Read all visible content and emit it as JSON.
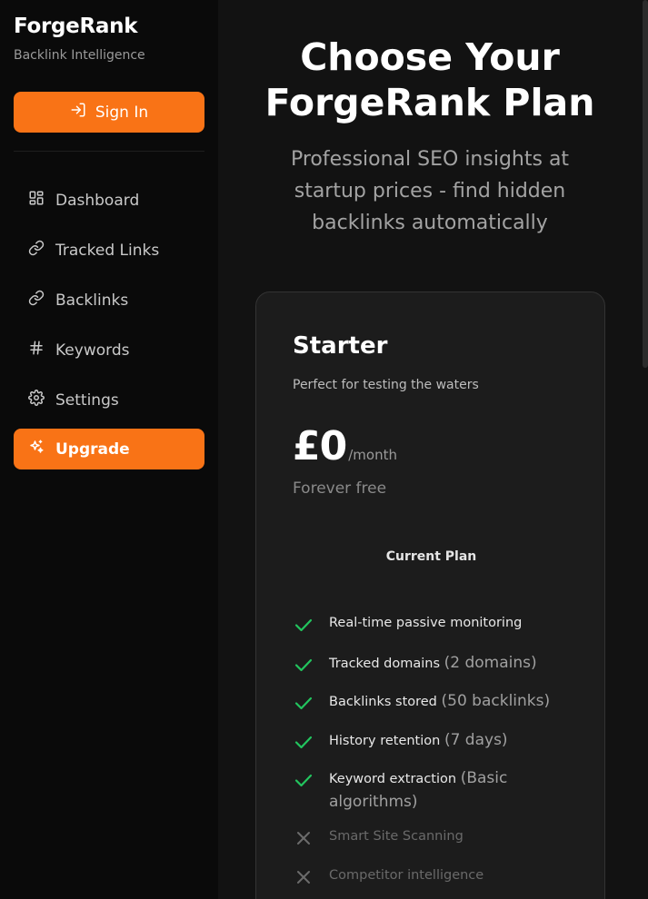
{
  "sidebar": {
    "brand": "ForgeRank",
    "tagline": "Backlink Intelligence",
    "sign_in_label": "Sign In",
    "nav": [
      {
        "label": "Dashboard",
        "icon": "dashboard-icon"
      },
      {
        "label": "Tracked Links",
        "icon": "link-icon"
      },
      {
        "label": "Backlinks",
        "icon": "link-icon"
      },
      {
        "label": "Keywords",
        "icon": "hash-icon"
      },
      {
        "label": "Settings",
        "icon": "gear-icon"
      },
      {
        "label": "Upgrade",
        "icon": "sparkles-icon",
        "active": true
      }
    ]
  },
  "main": {
    "title": "Choose Your ForgeRank Plan",
    "subtitle": "Professional SEO insights at startup prices - find hidden backlinks automatically"
  },
  "plan": {
    "name": "Starter",
    "description": "Perfect for testing the waters",
    "price": "£0",
    "period": "/month",
    "note": "Forever free",
    "cta": "Current Plan",
    "features": [
      {
        "text": "Real-time passive monitoring",
        "extra": "",
        "included": true
      },
      {
        "text": "Tracked domains",
        "extra": "(2 domains)",
        "included": true
      },
      {
        "text": "Backlinks stored",
        "extra": "(50 backlinks)",
        "included": true
      },
      {
        "text": "History retention",
        "extra": "(7 days)",
        "included": true
      },
      {
        "text": "Keyword extraction",
        "extra": "(Basic algorithms)",
        "included": true
      },
      {
        "text": "Smart Site Scanning",
        "extra": "",
        "included": false
      },
      {
        "text": "Competitor intelligence",
        "extra": "",
        "included": false
      }
    ]
  },
  "colors": {
    "accent": "#f97316",
    "check": "#22c55e",
    "cross": "#6b6b6b"
  }
}
